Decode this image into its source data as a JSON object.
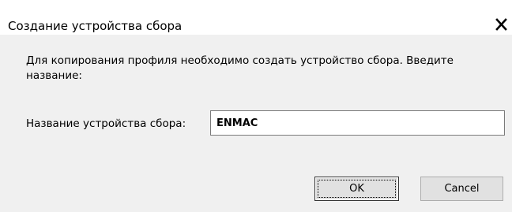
{
  "dialog": {
    "title": "Создание устройства сбора",
    "close_symbol": "X",
    "close_icon": "close-icon",
    "message": "Для копирования профиля необходимо создать устройство сбора. Введите название:",
    "field_label": "Название устройства сбора:",
    "field_value": "ENMAC",
    "ok_label": "OK",
    "cancel_label": "Cancel"
  },
  "colors": {
    "title_background": "#ffffff",
    "body_background": "#f0f0f0",
    "button_face": "#e1e1e1",
    "button_border": "#adadad",
    "default_button_border": "#333333",
    "input_border": "#7a7a7a"
  }
}
